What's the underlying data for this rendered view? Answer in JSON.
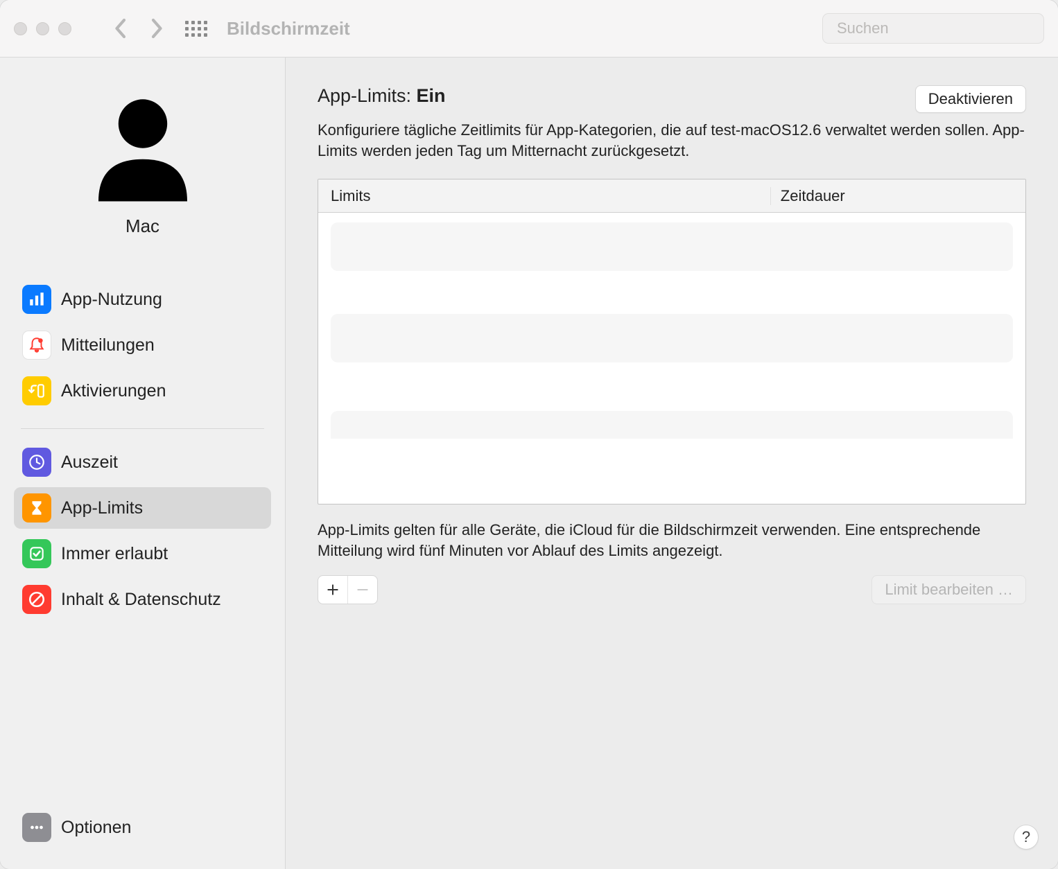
{
  "window": {
    "title": "Bildschirmzeit",
    "search_placeholder": "Suchen"
  },
  "profile": {
    "name": "Mac"
  },
  "sidebar": {
    "group1": [
      {
        "id": "usage",
        "label": "App-Nutzung"
      },
      {
        "id": "notifications",
        "label": "Mitteilungen"
      },
      {
        "id": "pickups",
        "label": "Aktivierungen"
      }
    ],
    "group2": [
      {
        "id": "downtime",
        "label": "Auszeit"
      },
      {
        "id": "applimits",
        "label": "App-Limits",
        "selected": true
      },
      {
        "id": "always",
        "label": "Immer erlaubt"
      },
      {
        "id": "content",
        "label": "Inhalt & Datenschutz"
      }
    ],
    "options_label": "Optionen"
  },
  "main": {
    "heading_prefix": "App-Limits: ",
    "heading_state": "Ein",
    "deactivate_label": "Deaktivieren",
    "description": "Konfiguriere tägliche Zeitlimits für App-Kategorien, die auf test-macOS12.6 verwaltet werden sollen. App-Limits werden jeden Tag um Mitternacht zurückgesetzt.",
    "table": {
      "col_limits": "Limits",
      "col_duration": "Zeitdauer",
      "rows": []
    },
    "footer_note": "App-Limits gelten für alle Geräte, die iCloud für die Bildschirmzeit verwenden. Eine entsprechende Mitteilung wird fünf Minuten vor Ablauf des Limits angezeigt.",
    "edit_label": "Limit bearbeiten …",
    "help_label": "?"
  }
}
